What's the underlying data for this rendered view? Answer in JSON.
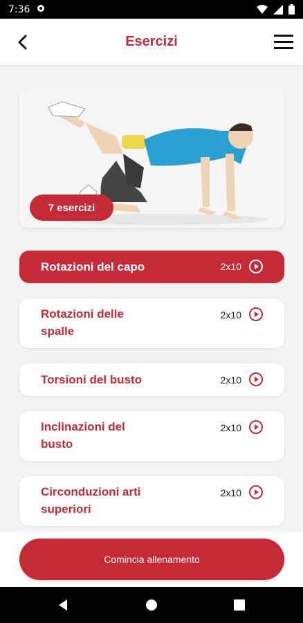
{
  "status_bar": {
    "time": "7:36"
  },
  "app_bar": {
    "title": "Esercizi"
  },
  "hero": {
    "badge": "7 esercizi"
  },
  "exercises": [
    {
      "line1": "Rotazioni del capo",
      "line2": "",
      "reps": "2x10",
      "active": true
    },
    {
      "line1": "Rotazioni delle",
      "line2": "spalle",
      "reps": "2x10",
      "active": false
    },
    {
      "line1": "Torsioni del busto",
      "line2": "",
      "reps": "2x10",
      "active": false
    },
    {
      "line1": "Inclinazioni del",
      "line2": "busto",
      "reps": "2x10",
      "active": false
    },
    {
      "line1": "Circonduzioni arti",
      "line2": "superiori",
      "reps": "2x10",
      "active": false
    }
  ],
  "cta": {
    "label": "Comincia allenamento"
  },
  "colors": {
    "accent": "#c62a36",
    "background": "#f3f3f3"
  },
  "icons": {
    "back": "arrow-left-icon",
    "menu": "hamburger-menu-icon",
    "play": "play-circle-icon"
  }
}
